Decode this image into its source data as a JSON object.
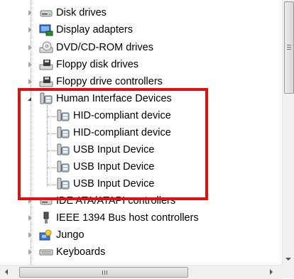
{
  "tree": {
    "items": [
      {
        "label": "Disk drives",
        "icon": "disk-drive-icon"
      },
      {
        "label": "Display adapters",
        "icon": "display-adapter-icon"
      },
      {
        "label": "DVD/CD-ROM drives",
        "icon": "dvd-drive-icon"
      },
      {
        "label": "Floppy disk drives",
        "icon": "floppy-drive-icon"
      },
      {
        "label": "Floppy drive controllers",
        "icon": "floppy-controller-icon"
      },
      {
        "label": "Human Interface Devices",
        "icon": "hid-icon",
        "expanded": true
      },
      {
        "label": "IDE ATA/ATAPI controllers",
        "icon": "ide-controller-icon"
      },
      {
        "label": "IEEE 1394 Bus host controllers",
        "icon": "ieee1394-icon"
      },
      {
        "label": "Jungo",
        "icon": "jungo-icon"
      },
      {
        "label": "Keyboards",
        "icon": "keyboard-icon"
      }
    ],
    "hid_children": [
      {
        "label": "HID-compliant device",
        "icon": "hid-device-icon"
      },
      {
        "label": "HID-compliant device",
        "icon": "hid-device-icon"
      },
      {
        "label": "USB Input Device",
        "icon": "hid-device-icon"
      },
      {
        "label": "USB Input Device",
        "icon": "hid-device-icon"
      },
      {
        "label": "USB Input Device",
        "icon": "hid-device-icon"
      }
    ]
  },
  "scrollbar": {
    "horizontal_grip": "III"
  },
  "colors": {
    "highlight_border": "#e01010"
  }
}
